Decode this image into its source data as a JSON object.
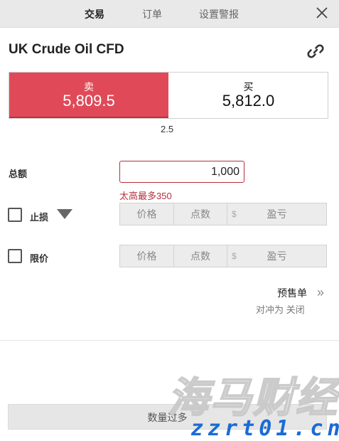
{
  "tabs": {
    "trade": "交易",
    "orders": "订单",
    "alerts": "设置警报"
  },
  "instrument": {
    "name": "UK Crude Oil CFD"
  },
  "sell": {
    "label": "卖",
    "price": "5,809.5"
  },
  "buy": {
    "label": "买",
    "price": "5,812.0"
  },
  "spread": "2.5",
  "amount": {
    "label": "总额",
    "value": "1,000",
    "error": "太高最多350"
  },
  "stop_loss": {
    "label": "止损",
    "price": "价格",
    "points": "点数",
    "currency": "$",
    "pnl": "盈亏"
  },
  "limit": {
    "label": "限价",
    "price": "价格",
    "points": "点数",
    "currency": "$",
    "pnl": "盈亏"
  },
  "pre_order": {
    "label": "预售单",
    "hedge": "对冲为 关闭"
  },
  "submit": {
    "label": "数量过多"
  },
  "watermark": {
    "cn": "海马财经",
    "url": "zzrt01.cn"
  },
  "colors": {
    "sell_red": "#e04a58",
    "error_red": "#b3303d",
    "watermark_blue": "#1a6bd6"
  }
}
